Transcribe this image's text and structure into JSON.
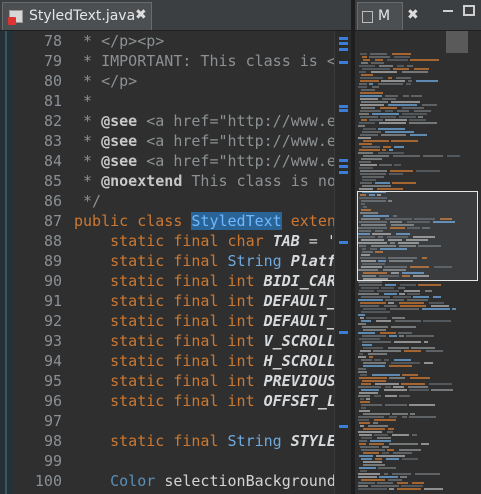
{
  "editor": {
    "tab_title": "StyledText.java",
    "close_glyph": "✖",
    "lines": [
      {
        "num": "78",
        "segments": [
          {
            "c": "cm",
            "t": " * </p><p>"
          }
        ]
      },
      {
        "num": "79",
        "segments": [
          {
            "c": "cm",
            "t": " * IMPORTANT: This class is <"
          }
        ]
      },
      {
        "num": "80",
        "segments": [
          {
            "c": "cm",
            "t": " * </p>"
          }
        ]
      },
      {
        "num": "81",
        "segments": [
          {
            "c": "cm",
            "t": " *"
          }
        ]
      },
      {
        "num": "82",
        "segments": [
          {
            "c": "cm",
            "t": " * "
          },
          {
            "c": "ann",
            "t": "@see"
          },
          {
            "c": "cm",
            "t": " <a href=\"http://www.ec"
          }
        ]
      },
      {
        "num": "83",
        "segments": [
          {
            "c": "cm",
            "t": " * "
          },
          {
            "c": "ann",
            "t": "@see"
          },
          {
            "c": "cm",
            "t": " <a href=\"http://www.ec"
          }
        ]
      },
      {
        "num": "84",
        "segments": [
          {
            "c": "cm",
            "t": " * "
          },
          {
            "c": "ann",
            "t": "@see"
          },
          {
            "c": "cm",
            "t": " <a href=\"http://www.ec"
          }
        ]
      },
      {
        "num": "85",
        "segments": [
          {
            "c": "cm",
            "t": " * "
          },
          {
            "c": "ann",
            "t": "@noextend"
          },
          {
            "c": "cm",
            "t": " This class is not"
          }
        ]
      },
      {
        "num": "86",
        "segments": [
          {
            "c": "cm",
            "t": " */"
          }
        ]
      },
      {
        "num": "87",
        "segments": [
          {
            "c": "kw",
            "t": "public class "
          },
          {
            "c": "hl",
            "t": "StyledText"
          },
          {
            "c": "kw",
            "t": " exten"
          }
        ]
      },
      {
        "num": "88",
        "segments": [
          {
            "c": "kw",
            "t": "    static final "
          },
          {
            "c": "pu",
            "t": "char "
          },
          {
            "c": "it",
            "t": "TAB"
          },
          {
            "c": "plain",
            "t": " = '"
          }
        ]
      },
      {
        "num": "89",
        "segments": [
          {
            "c": "kw",
            "t": "    static final "
          },
          {
            "c": "ty",
            "t": "String "
          },
          {
            "c": "it",
            "t": "Platfo"
          }
        ]
      },
      {
        "num": "90",
        "segments": [
          {
            "c": "kw",
            "t": "    static final "
          },
          {
            "c": "pu",
            "t": "int "
          },
          {
            "c": "it",
            "t": "BIDI_CAR"
          }
        ]
      },
      {
        "num": "91",
        "segments": [
          {
            "c": "kw",
            "t": "    static final "
          },
          {
            "c": "pu",
            "t": "int "
          },
          {
            "c": "it",
            "t": "DEFAULT_W"
          }
        ]
      },
      {
        "num": "92",
        "segments": [
          {
            "c": "kw",
            "t": "    static final "
          },
          {
            "c": "pu",
            "t": "int "
          },
          {
            "c": "it",
            "t": "DEFAULT_H"
          }
        ]
      },
      {
        "num": "93",
        "segments": [
          {
            "c": "kw",
            "t": "    static final "
          },
          {
            "c": "pu",
            "t": "int "
          },
          {
            "c": "it",
            "t": "V_SCROLL"
          }
        ]
      },
      {
        "num": "94",
        "segments": [
          {
            "c": "kw",
            "t": "    static final "
          },
          {
            "c": "pu",
            "t": "int "
          },
          {
            "c": "it",
            "t": "H_SCROLL"
          }
        ]
      },
      {
        "num": "95",
        "segments": [
          {
            "c": "kw",
            "t": "    static final "
          },
          {
            "c": "pu",
            "t": "int "
          },
          {
            "c": "it",
            "t": "PREVIOUS"
          }
        ]
      },
      {
        "num": "96",
        "segments": [
          {
            "c": "kw",
            "t": "    static final "
          },
          {
            "c": "pu",
            "t": "int "
          },
          {
            "c": "it",
            "t": "OFFSET_L"
          }
        ]
      },
      {
        "num": "97",
        "segments": []
      },
      {
        "num": "98",
        "segments": [
          {
            "c": "kw",
            "t": "    static final "
          },
          {
            "c": "ty",
            "t": "String "
          },
          {
            "c": "it",
            "t": "STYLE"
          }
        ]
      },
      {
        "num": "99",
        "segments": []
      },
      {
        "num": "100",
        "segments": [
          {
            "c": "bl",
            "t": "    Color "
          },
          {
            "c": "plain",
            "t": "selectionBackground"
          }
        ]
      }
    ]
  },
  "minimap": {
    "tab_title": "M",
    "close_glyph": "✖"
  },
  "colors": {
    "keyword": "#cc7832",
    "highlight_bg": "#2a6496",
    "comment": "#8c9193",
    "type": "#6fa8dc"
  }
}
